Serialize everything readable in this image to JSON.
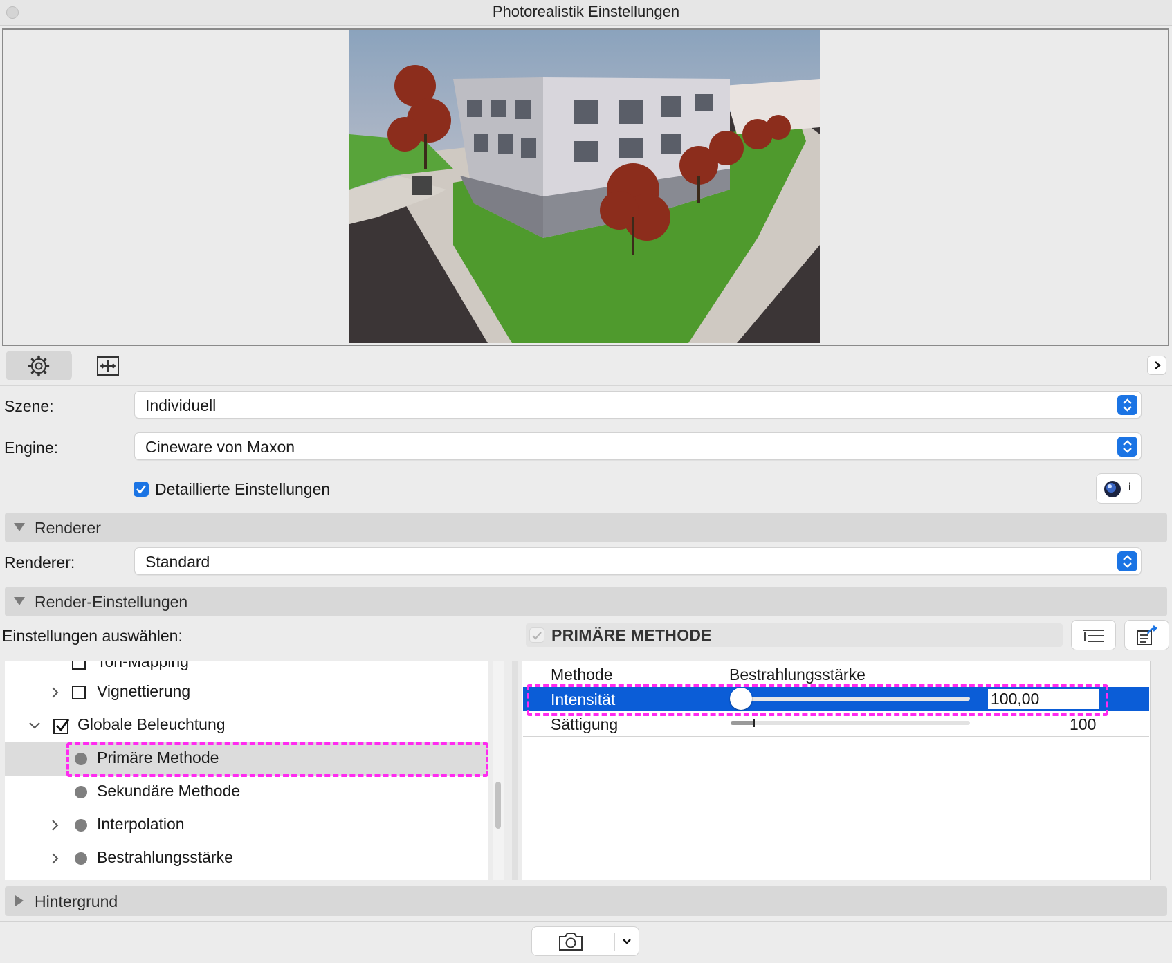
{
  "window": {
    "title": "Photorealistik Einstellungen"
  },
  "toolbar": {
    "gear_icon": "gear-icon",
    "frame_icon": "frame-icon",
    "expand_icon": "chevron-right-icon"
  },
  "form": {
    "scene_label": "Szene:",
    "scene_value": "Individuell",
    "engine_label": "Engine:",
    "engine_value": "Cineware von Maxon",
    "detailed_label": "Detaillierte Einstellungen",
    "detailed_checked": true
  },
  "sections": {
    "renderer": "Renderer",
    "renderer_label": "Renderer:",
    "renderer_value": "Standard",
    "render_settings": "Render-Einstellungen",
    "background": "Hintergrund"
  },
  "settings": {
    "select_label": "Einstellungen auswählen:",
    "method_header": "PRIMÄRE METHODE"
  },
  "tree": [
    {
      "label": "Ton-Mapping",
      "kind": "checkbox",
      "checked": false
    },
    {
      "label": "Vignettierung",
      "kind": "checkbox",
      "checked": false,
      "expandable": true
    },
    {
      "label": "Globale Beleuchtung",
      "kind": "checkbox",
      "checked": true,
      "expanded": true
    },
    {
      "label": "Primäre Methode",
      "kind": "dot",
      "selected": true
    },
    {
      "label": "Sekundäre Methode",
      "kind": "dot"
    },
    {
      "label": "Interpolation",
      "kind": "dot",
      "expandable": true
    },
    {
      "label": "Bestrahlungsstärke",
      "kind": "dot",
      "expandable": true
    }
  ],
  "properties": {
    "method_label": "Methode",
    "method_value": "Bestrahlungsstärke",
    "intensity_label": "Intensität",
    "intensity_value": "100,00",
    "intensity_slider_fraction": 0.0,
    "saturation_label": "Sättigung",
    "saturation_value": "100",
    "saturation_slider_fraction": 0.1
  },
  "colors": {
    "accent": "#1b74e4",
    "selection": "#0b5dd7",
    "highlight": "#ff2bf0"
  }
}
